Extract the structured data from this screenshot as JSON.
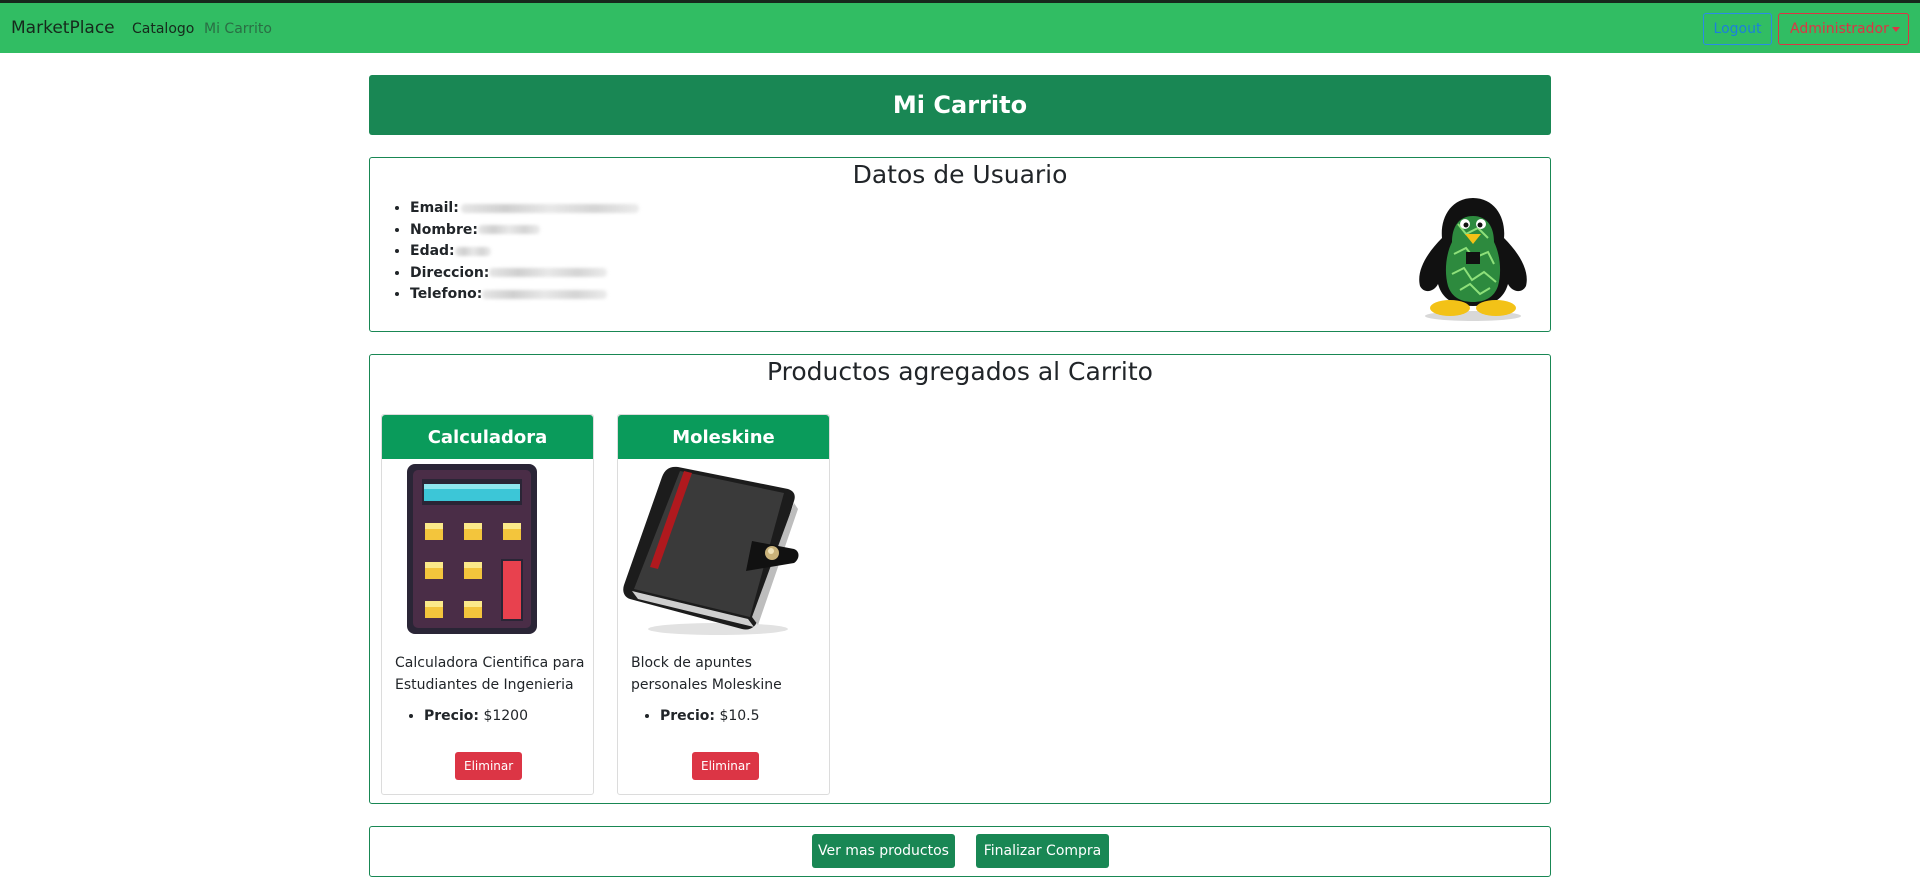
{
  "navbar": {
    "brand": "MarketPlace",
    "links": [
      "Catalogo",
      "Mi Carrito"
    ],
    "logout_label": "Logout",
    "admin_label": "Administrador"
  },
  "header": {
    "title": "Mi Carrito"
  },
  "user": {
    "title": "Datos de Usuario",
    "fields": [
      {
        "label": "Email:"
      },
      {
        "label": "Nombre:"
      },
      {
        "label": "Edad:"
      },
      {
        "label": "Direccion:"
      },
      {
        "label": "Telefono:"
      }
    ],
    "avatar_icon": "tux-penguin-icon"
  },
  "cart": {
    "title": "Productos agregados al Carrito",
    "products": [
      {
        "name": "Calculadora",
        "description": "Calculadora Cientifica para Estudiantes de Ingenieria",
        "price_label": "Precio:",
        "price": "$1200",
        "remove_label": "Eliminar",
        "image_icon": "calculator-icon"
      },
      {
        "name": "Moleskine",
        "description": "Block de apuntes personales Moleskine",
        "price_label": "Precio:",
        "price": "$10.5",
        "remove_label": "Eliminar",
        "image_icon": "notebook-icon"
      }
    ]
  },
  "actions": {
    "more_label": "Ver mas productos",
    "finish_label": "Finalizar Compra"
  },
  "colors": {
    "navbar": "#31bd63",
    "primary_green": "#198754",
    "card_header": "#0a9b5b",
    "danger": "#dc3545",
    "info": "#1b7fdd"
  }
}
